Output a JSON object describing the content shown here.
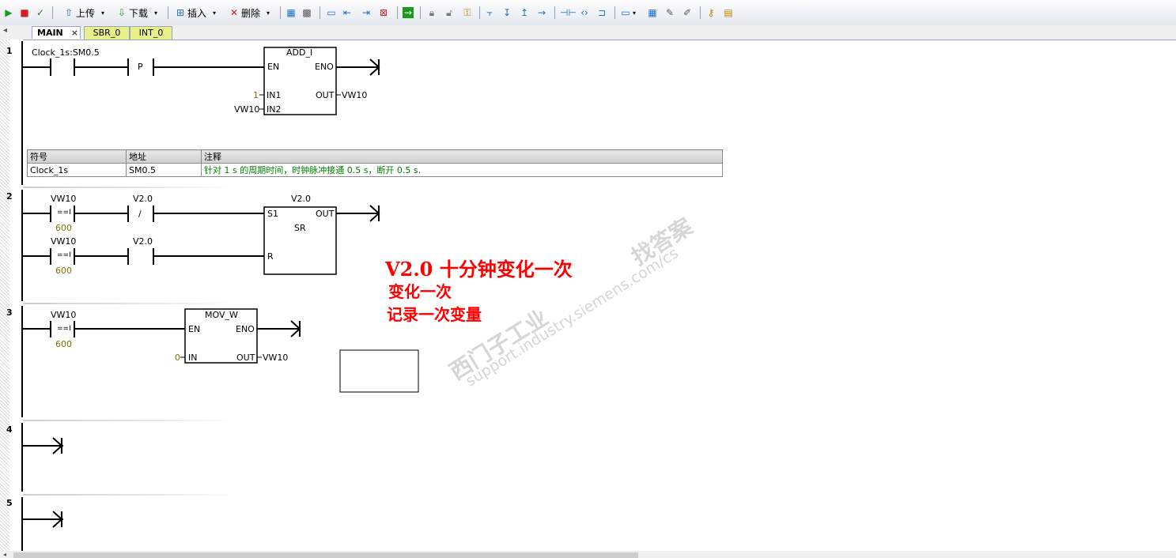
{
  "toolbar": {
    "upload_label": "上传",
    "download_label": "下载",
    "insert_label": "插入",
    "delete_label": "删除"
  },
  "tabs": [
    {
      "label": "MAIN"
    },
    {
      "label": "SBR_0"
    },
    {
      "label": "INT_0"
    }
  ],
  "tab_close": "×",
  "rungs": {
    "r1": {
      "number": "1",
      "contact_label": "Clock_1s:SM0.5",
      "p_label": "P",
      "block_title": "ADD_I",
      "en": "EN",
      "eno": "ENO",
      "in1": "IN1",
      "in2": "IN2",
      "out": "OUT",
      "in1_value": "1",
      "in2_value": "VW10",
      "out_value": "VW10",
      "symbol_table": {
        "headers": [
          "符号",
          "地址",
          "注释"
        ],
        "row": [
          "Clock_1s",
          "SM0.5",
          "针对 1 s 的周期时间，时钟脉冲接通 0.5 s，断开 0.5 s."
        ]
      }
    },
    "r2": {
      "number": "2",
      "c1_top": "VW10",
      "c1_mid": "==I",
      "c1_bot": "600",
      "c2_top": "V2.0",
      "c2_mid": "/",
      "c3_top": "VW10",
      "c3_mid": "==I",
      "c3_bot": "600",
      "c4_top": "V2.0",
      "block_top": "V2.0",
      "block_title": "SR",
      "s1": "S1",
      "r": "R",
      "out": "OUT"
    },
    "r3": {
      "number": "3",
      "c1_top": "VW10",
      "c1_mid": "==I",
      "c1_bot": "600",
      "block_title": "MOV_W",
      "en": "EN",
      "eno": "ENO",
      "in": "IN",
      "out": "OUT",
      "in_value": "0",
      "out_value": "VW10"
    },
    "r4": {
      "number": "4"
    },
    "r5": {
      "number": "5"
    }
  },
  "annotation": {
    "line1": "V2.0 十分钟变化一次",
    "line2": "变化一次",
    "line3": "记录一次变量"
  },
  "watermark": {
    "line1": "西门子工业",
    "line2": "找答案",
    "url": "support.industry.siemens.com/cs"
  },
  "colors": {
    "annotation": "#ff0000",
    "comment_text": "#008000",
    "constant": "#807000",
    "tab_active": "#ffffff",
    "tab_inactive": "#e7f08c"
  }
}
